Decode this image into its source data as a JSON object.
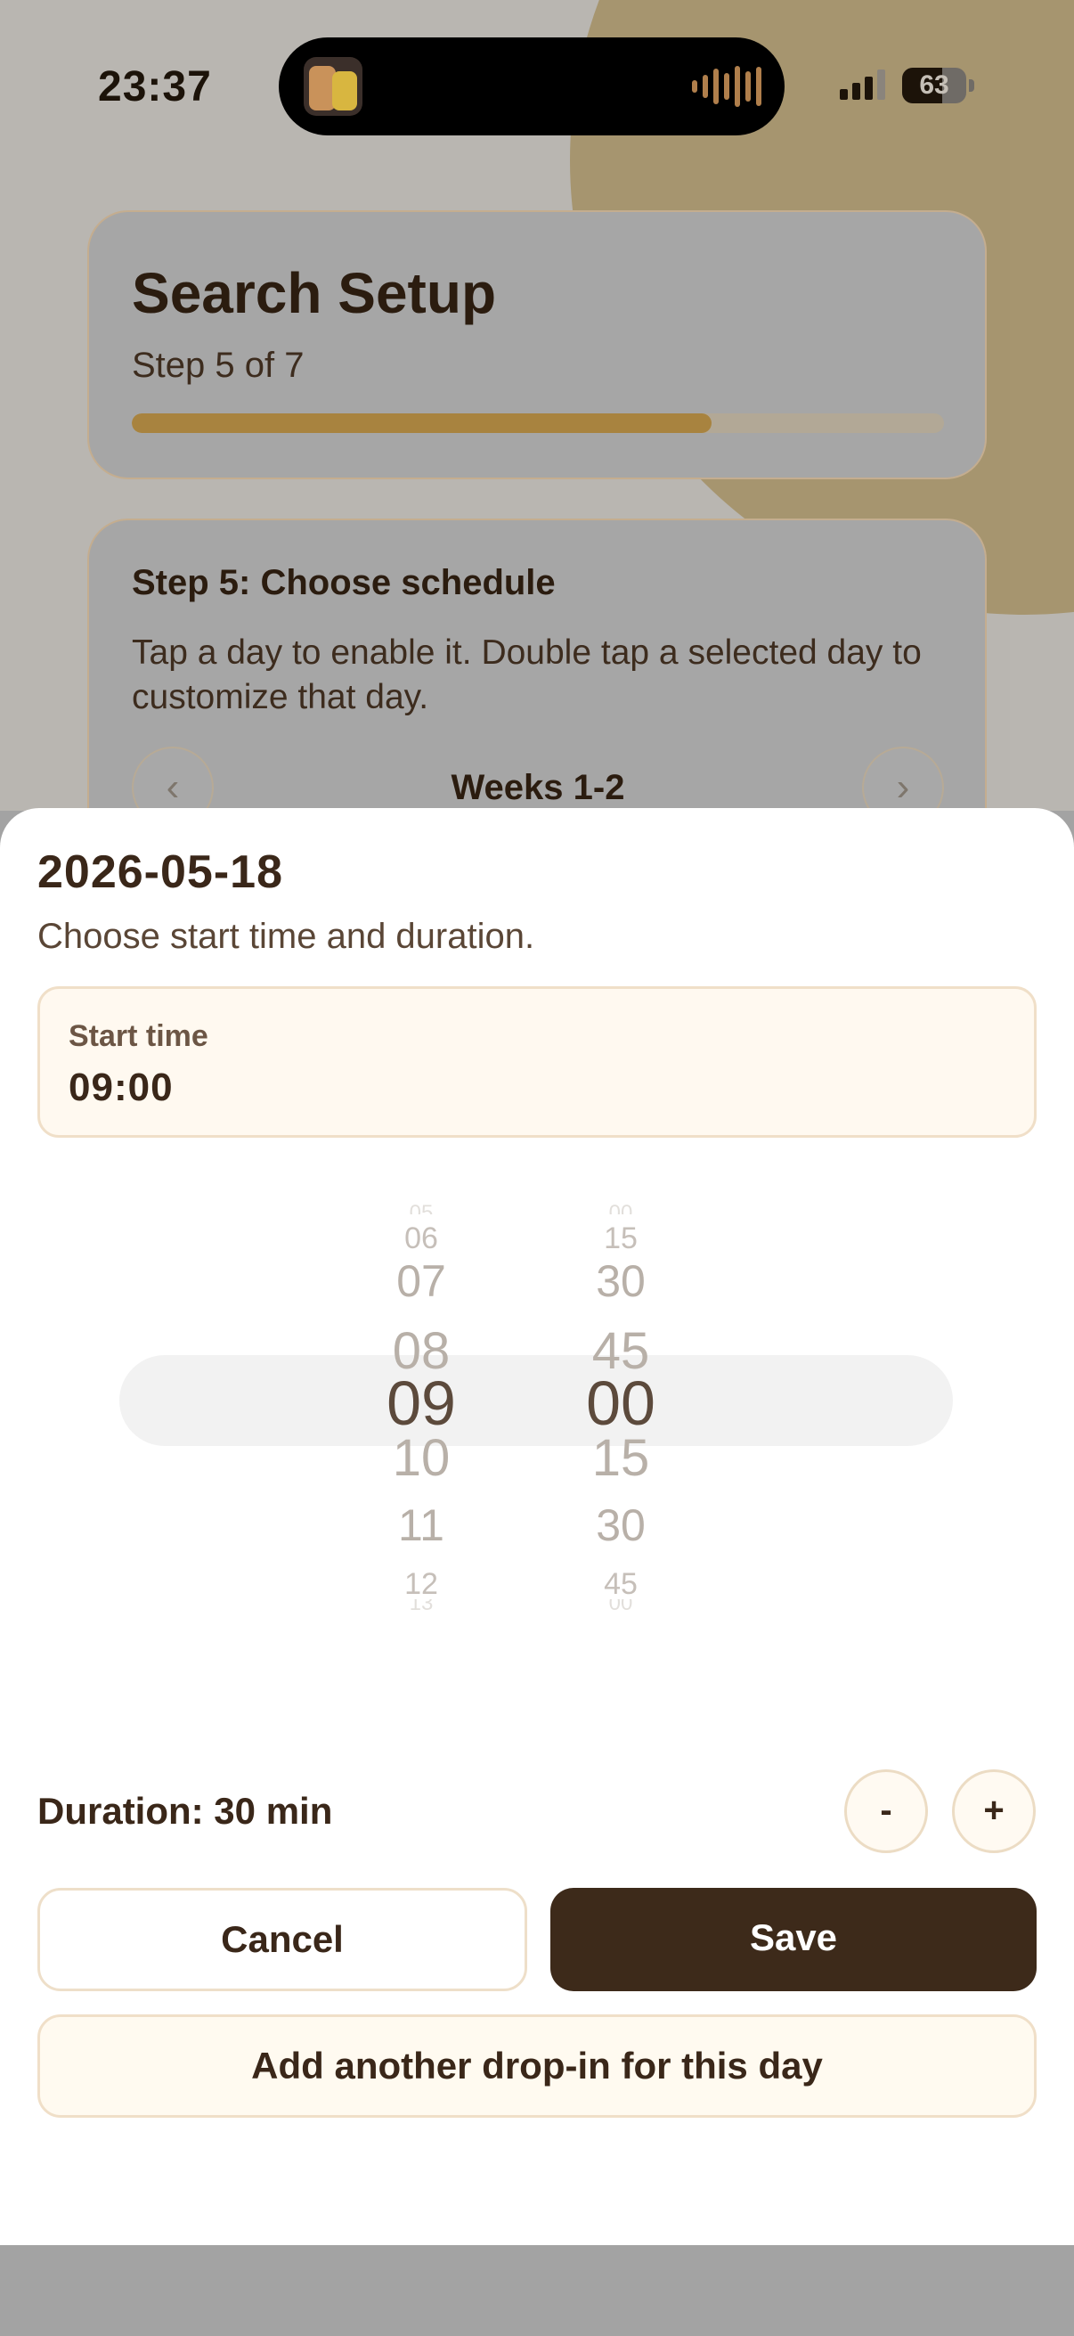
{
  "status_bar": {
    "time": "23:37",
    "battery": "63",
    "battery_level": 0.63
  },
  "setup": {
    "title": "Search Setup",
    "step_text": "Step 5 of 7",
    "progress": 0.714
  },
  "step_card": {
    "heading": "Step 5: Choose schedule",
    "description": "Tap a day to enable it. Double tap a selected day to customize that day.",
    "week_label": "Weeks 1-2",
    "prev_icon": "chevron-left-icon",
    "next_icon": "chevron-right-icon"
  },
  "sheet": {
    "date": "2026-05-18",
    "subtitle": "Choose start time and duration.",
    "start_time_label": "Start time",
    "start_time_value": "09:00",
    "picker": {
      "hours": [
        "05",
        "06",
        "07",
        "08",
        "09",
        "10",
        "11",
        "12",
        "13"
      ],
      "minutes": [
        "00",
        "15",
        "30",
        "45",
        "00",
        "15",
        "30",
        "45",
        "00"
      ],
      "selected_hour": "09",
      "selected_minute": "00"
    },
    "duration_text": "Duration: 30 min",
    "minus_label": "-",
    "plus_label": "+",
    "cancel_label": "Cancel",
    "save_label": "Save",
    "add_dropin_label": "Add another drop-in for this day"
  },
  "colors": {
    "accent_gold": "#a8833f",
    "save_button": "#3d2a1a",
    "cream": "#fff9f0"
  }
}
